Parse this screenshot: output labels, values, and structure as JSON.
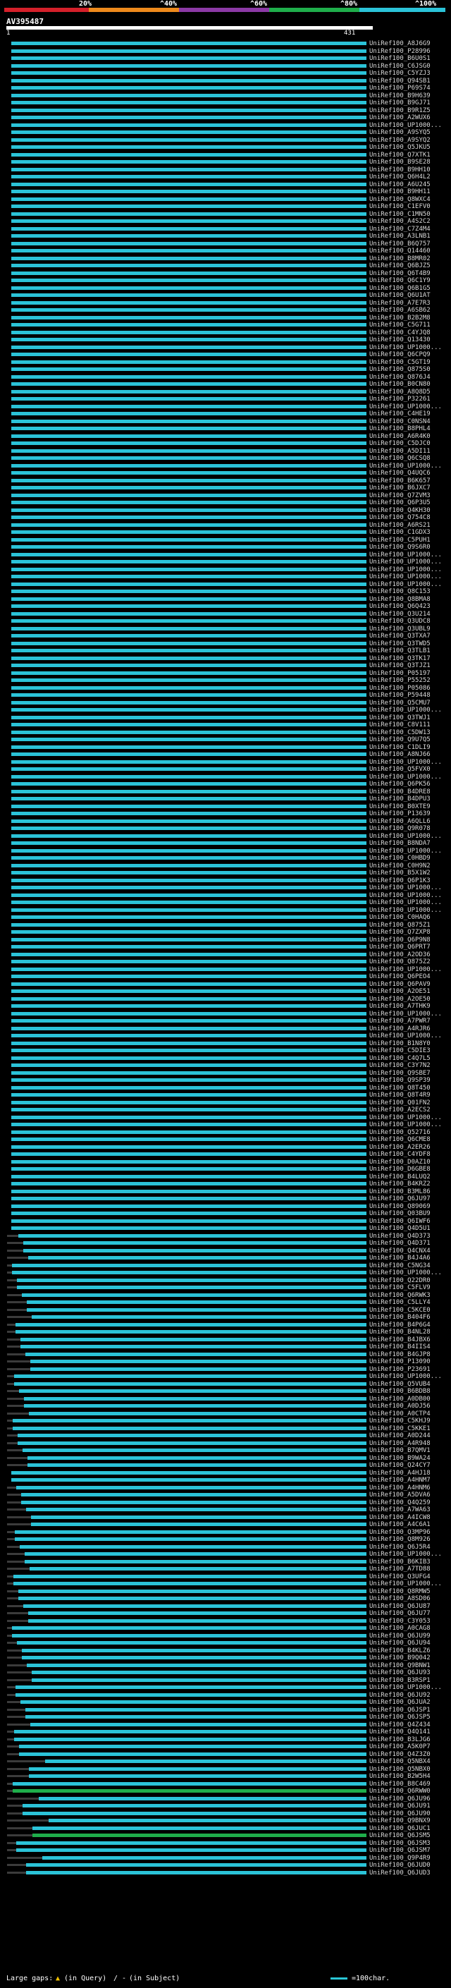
{
  "scale": {
    "ticks": [
      "20%",
      "^40%",
      "^60%",
      "^80%",
      "^100%"
    ],
    "colors": [
      "#d4202a",
      "#ee8a1c",
      "#8c3aa6",
      "#1fae4b",
      "#2bc3d8"
    ]
  },
  "query": {
    "id": "AV395487",
    "start": "1",
    "end": "431"
  },
  "rows": [
    "UniRef100_A8J6G9",
    "UniRef100_P28996",
    "UniRef100_B6U0S1",
    "UniRef100_C6JSG0",
    "UniRef100_C5YZJ3",
    "UniRef100_Q94SB1",
    "UniRef100_P69S74",
    "UniRef100_B9H639",
    "UniRef100_B9GJ71",
    "UniRef100_B9R1Z5",
    "UniRef100_A2WUX6",
    "UniRef100_UP1000...",
    "UniRef100_A9SYQ5",
    "UniRef100_A9SYQ2",
    "UniRef100_Q5JKU5",
    "UniRef100_Q7XTK1",
    "UniRef100_B9SE28",
    "UniRef100_B9HH10",
    "UniRef100_Q6H4L2",
    "UniRef100_A6U245",
    "UniRef100_B9HH11",
    "UniRef100_Q8WXC4",
    "UniRef100_C1EFV0",
    "UniRef100_C1MN50",
    "UniRef100_A4S2C2",
    "UniRef100_C7Z4M4",
    "UniRef100_A3LNB1",
    "UniRef100_B6Q757",
    "UniRef100_Q14460",
    "UniRef100_B8MR02",
    "UniRef100_Q6BJZ5",
    "UniRef100_Q6T4B9",
    "UniRef100_Q6C1Y9",
    "UniRef100_Q6B1G5",
    "UniRef100_Q6U1AT",
    "UniRef100_A7E7R3",
    "UniRef100_A6SB62",
    "UniRef100_B2B2M8",
    "UniRef100_C5G711",
    "UniRef100_C4YJQ8",
    "UniRef100_Q13430",
    "UniRef100_UP1000...",
    "UniRef100_Q6CPQ9",
    "UniRef100_C5GT19",
    "UniRef100_Q875S0",
    "UniRef100_Q876J4",
    "UniRef100_B0CN80",
    "UniRef100_A8Q8D5",
    "UniRef100_P32261",
    "UniRef100_UP1000...",
    "UniRef100_C4HE19",
    "UniRef100_C0NSN4",
    "UniRef100_B8PHL4",
    "UniRef100_A6R4K0",
    "UniRef100_C5DJC0",
    "UniRef100_A5DI11",
    "UniRef100_Q6CSQ8",
    "UniRef100_UP1000...",
    "UniRef100_Q4UQC6",
    "UniRef100_B6K657",
    "UniRef100_B6JXC7",
    "UniRef100_Q7ZVM3",
    "UniRef100_Q6P3U5",
    "UniRef100_Q4KH30",
    "UniRef100_Q754C8",
    "UniRef100_A6RS21",
    "UniRef100_C1GDX3",
    "UniRef100_C5PUH1",
    "UniRef100_Q9S6R0",
    "UniRef100_UP1000...",
    "UniRef100_UP1000...",
    "UniRef100_UP1000...",
    "UniRef100_UP1000...",
    "UniRef100_UP1000...",
    "UniRef100_Q8C153",
    "UniRef100_Q8BMA8",
    "UniRef100_Q6Q423",
    "UniRef100_Q3U214",
    "UniRef100_Q3UDC8",
    "UniRef100_Q3UBL9",
    "UniRef100_Q3TXA7",
    "UniRef100_Q3TWD5",
    "UniRef100_Q3TLB1",
    "UniRef100_Q3TK17",
    "UniRef100_Q3TJZ1",
    "UniRef100_P05197",
    "UniRef100_P55252",
    "UniRef100_P05086",
    "UniRef100_P59448",
    "UniRef100_Q5CMU7",
    "UniRef100_UP1000...",
    "UniRef100_Q3TWJ1",
    "UniRef100_C8V111",
    "UniRef100_C5DW13",
    "UniRef100_Q9U7Q5",
    "UniRef100_C1DLI9",
    "UniRef100_A8NJ66",
    "UniRef100_UP1000...",
    "UniRef100_Q5FVX0",
    "UniRef100_UP1000...",
    "UniRef100_Q6PK56",
    "UniRef100_B4DRE8",
    "UniRef100_B4DPU3",
    "UniRef100_B0XTE9",
    "UniRef100_P13639",
    "UniRef100_A6QLL6",
    "UniRef100_Q9R078",
    "UniRef100_UP1000...",
    "UniRef100_B8NDA7",
    "UniRef100_UP1000...",
    "UniRef100_C0HBD9",
    "UniRef100_C0H9N2",
    "UniRef100_B5X1W2",
    "UniRef100_Q6P1K3",
    "UniRef100_UP1000...",
    "UniRef100_UP1000...",
    "UniRef100_UP1000...",
    "UniRef100_UP1000...",
    "UniRef100_C0HAQ6",
    "UniRef100_Q875Z1",
    "UniRef100_Q7ZXP8",
    "UniRef100_Q6P9N8",
    "UniRef100_Q6PRT7",
    "UniRef100_A2OD36",
    "UniRef100_Q875Z2",
    "UniRef100_UP1000...",
    "UniRef100_Q6PEO4",
    "UniRef100_Q6PAV9",
    "UniRef100_A2OE51",
    "UniRef100_A2OE50",
    "UniRef100_A7THK9",
    "UniRef100_UP1000...",
    "UniRef100_A7PWR7",
    "UniRef100_A4RJR6",
    "UniRef100_UP1000...",
    "UniRef100_B1N8Y0",
    "UniRef100_C5DIE3",
    "UniRef100_C4Q7L5",
    "UniRef100_C3Y7N2",
    "UniRef100_Q9SBE7",
    "UniRef100_Q9SP39",
    "UniRef100_Q8T450",
    "UniRef100_Q8T4R9",
    "UniRef100_Q01FN2",
    "UniRef100_A2ECS2",
    "UniRef100_UP1000...",
    "UniRef100_UP1000...",
    "UniRef100_Q52716",
    "UniRef100_Q6CME8",
    "UniRef100_A2ER26",
    "UniRef100_C4YDF8",
    "UniRef100_D0AZ10",
    "UniRef100_D6GBE8",
    "UniRef100_B4LUQ2",
    "UniRef100_B4KRZ2",
    "UniRef100_B3ML86",
    "UniRef100_Q6JU97",
    "UniRef100_Q89069",
    "UniRef100_Q03BU9",
    "UniRef100_Q6IWF6",
    "UniRef100_Q4D5U1",
    "UniRef100_Q4D373",
    "UniRef100_Q4D371",
    "UniRef100_Q4CNX4",
    "UniRef100_B4J4A6",
    "UniRef100_C5NG34",
    "UniRef100_UP1000...",
    "UniRef100_Q22DR0",
    "UniRef100_C5FLV9",
    "UniRef100_Q6RWK3",
    "UniRef100_C5LLY4",
    "UniRef100_C5KCE0",
    "UniRef100_B404F6",
    "UniRef100_B4P6G4",
    "UniRef100_B4NL28",
    "UniRef100_B4JBX6",
    "UniRef100_B4IIS4",
    "UniRef100_B4GJP8",
    "UniRef100_P13090",
    "UniRef100_P23691",
    "UniRef100_UP1000...",
    "UniRef100_Q5VUB4",
    "UniRef100_B6BDB8",
    "UniRef100_A0DB00",
    "UniRef100_A0DJ56",
    "UniRef100_A0CTP4",
    "UniRef100_C5KHJ9",
    "UniRef100_C5KKE1",
    "UniRef100_A0D244",
    "UniRef100_A4R948",
    "UniRef100_B7QMV1",
    "UniRef100_B9WA24",
    "UniRef100_Q24CY7",
    "UniRef100_A4HJ18",
    "UniRef100_A4HNM7",
    "UniRef100_A4HNM6",
    "UniRef100_A5DVA6",
    "UniRef100_Q4Q259",
    "UniRef100_A7WA63",
    "UniRef100_A4ICW8",
    "UniRef100_A4C6A1",
    "UniRef100_Q3MP96",
    "UniRef100_Q8M926",
    "UniRef100_Q6J5R4",
    "UniRef100_UP1000...",
    "UniRef100_B6KIB3",
    "UniRef100_A7TD88",
    "UniRef100_Q3UFG4",
    "UniRef100_UP1000...",
    "UniRef100_Q8RMW5",
    "UniRef100_A8SD06",
    "UniRef100_Q6JU87",
    "UniRef100_Q6JU77",
    "UniRef100_C3Y053",
    "UniRef100_A0CAG8",
    "UniRef100_Q6JU99",
    "UniRef100_Q6JU94",
    "UniRef100_B4KLZ6",
    "UniRef100_B9Q042",
    "UniRef100_Q9BNW1",
    "UniRef100_Q6JU93",
    "UniRef100_B3RSP1",
    "UniRef100_UP1000...",
    "UniRef100_Q6JU92",
    "UniRef100_Q6JUA2",
    "UniRef100_Q6JSP1",
    "UniRef100_Q6JSP5",
    "UniRef100_Q4Z434",
    "UniRef100_Q4Q141",
    "UniRef100_B3LJG6",
    "UniRef100_A5K0P7",
    "UniRef100_Q4Z3Z0",
    "UniRef100_Q5NBX4",
    "UniRef100_Q5NBX0",
    "UniRef100_B2W5H4",
    "UniRef100_B8C469",
    "UniRef100_Q6RWW0",
    "UniRef100_Q6JU96",
    "UniRef100_Q6JU91",
    "UniRef100_Q6JU90",
    "UniRef100_Q9BNX9",
    "UniRef100_Q6JUC1",
    "UniRef100_Q6JSM5",
    "UniRef100_Q6JSM3",
    "UniRef100_Q6JSM7",
    "UniRef100_Q9P4R9",
    "UniRef100_Q6JUD0",
    "UniRef100_Q6JUD3"
  ],
  "legend": {
    "gaps_label": "Large gaps:",
    "in_query": "(in Query)",
    "in_subject": "(in Subject)",
    "scale_label": "=100char."
  }
}
